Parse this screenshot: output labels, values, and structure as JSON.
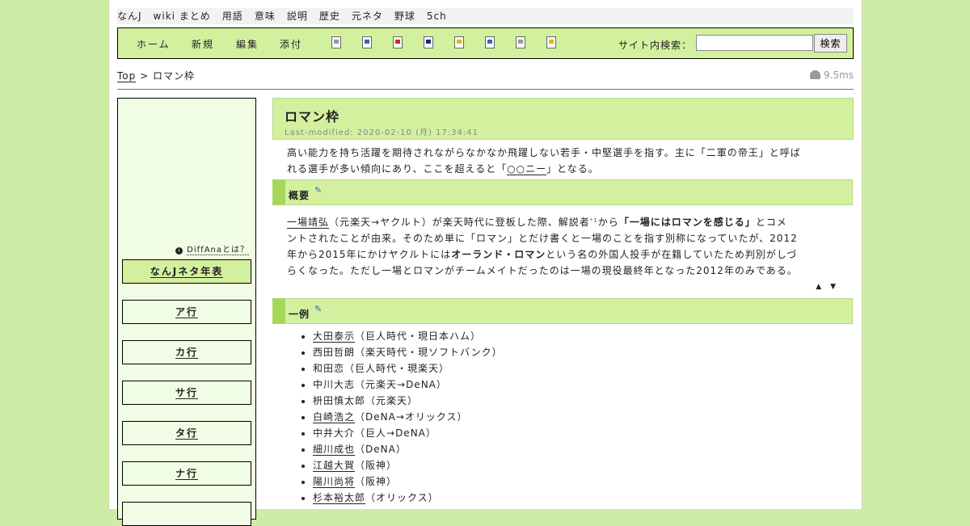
{
  "topnav": [
    "なんJ",
    "wiki まとめ",
    "用語",
    "意味",
    "説明",
    "歴史",
    "元ネタ",
    "野球",
    "5ch"
  ],
  "toolbar": {
    "buttons": [
      "ホーム",
      "新規",
      "編集",
      "添付"
    ],
    "icons": [
      "new-page-icon",
      "rename-icon",
      "delete-icon",
      "save-icon",
      "lock-icon",
      "copy-icon",
      "list-icon",
      "help-icon"
    ],
    "search_label": "サイト内検索：",
    "search_value": "",
    "search_button": "検索"
  },
  "breadcrumb": {
    "root": "Top",
    "sep": ">",
    "current": "ロマン枠"
  },
  "perf": "9.5ms",
  "sidebar": {
    "diffana": "DiffAnaとは？",
    "items": [
      "なんJネタ年表",
      "ア行",
      "カ行",
      "サ行",
      "タ行",
      "ナ行"
    ]
  },
  "article": {
    "title": "ロマン枠",
    "last_modified": "Last-modified: 2020-02-10 (月) 17:34:41",
    "intro": {
      "line1": "高い能力を持ち活躍を期待されながらなかなか飛躍しない若手・中堅選手を指す。主に「二軍の帝王」と呼ば",
      "line2_pre": "れる選手が多い傾向にあり、ここを超えると「",
      "line2_link": "○○ニー",
      "line2_post": "」となる。"
    },
    "sections": [
      {
        "heading": "概要",
        "body": {
          "l1_link": "一場靖弘",
          "l1_a": "（元楽天→ヤクルト）が楽天時代に登板した際、解説者",
          "l1_fn": "*1",
          "l1_b": "から",
          "l1_bold": "「一場にはロマンを感じる」",
          "l1_c": "とコメ",
          "l2": "ントされたことが由来。そのため単に「ロマン」とだけ書くと一場のことを指す別称になっていたが、2012",
          "l3_a": "年から2015年にかけヤクルトには",
          "l3_bold": "オーランド・ロマン",
          "l3_b": "という名の外国人投手が在籍していたため判別がしづ",
          "l4": "らくなった。ただし一場とロマンがチームメイトだったのは一場の現役最終年となった2012年のみである。"
        },
        "nav_arrows": "▲ ▼"
      },
      {
        "heading": "一例",
        "items": [
          {
            "name": "大田泰示",
            "link": true,
            "note": "（巨人時代・現日本ハム）"
          },
          {
            "name": "西田哲朗",
            "link": false,
            "note": "（楽天時代・現ソフトバンク）"
          },
          {
            "name": "和田恋",
            "link": false,
            "note": "（巨人時代・現楽天）"
          },
          {
            "name": "中川大志",
            "link": false,
            "note": "（元楽天→DeNA）"
          },
          {
            "name": "枡田慎太郎",
            "link": false,
            "note": "（元楽天）"
          },
          {
            "name": "白崎浩之",
            "link": true,
            "note": "（DeNA→オリックス）"
          },
          {
            "name": "中井大介",
            "link": false,
            "note": "（巨人→DeNA）"
          },
          {
            "name": "細川成也",
            "link": true,
            "note": "（DeNA）"
          },
          {
            "name": "江越大賀",
            "link": true,
            "note": "（阪神）"
          },
          {
            "name": "陽川尚将",
            "link": true,
            "note": "（阪神）"
          },
          {
            "name": "杉本裕太郎",
            "link": true,
            "note": "（オリックス）"
          }
        ]
      }
    ]
  }
}
